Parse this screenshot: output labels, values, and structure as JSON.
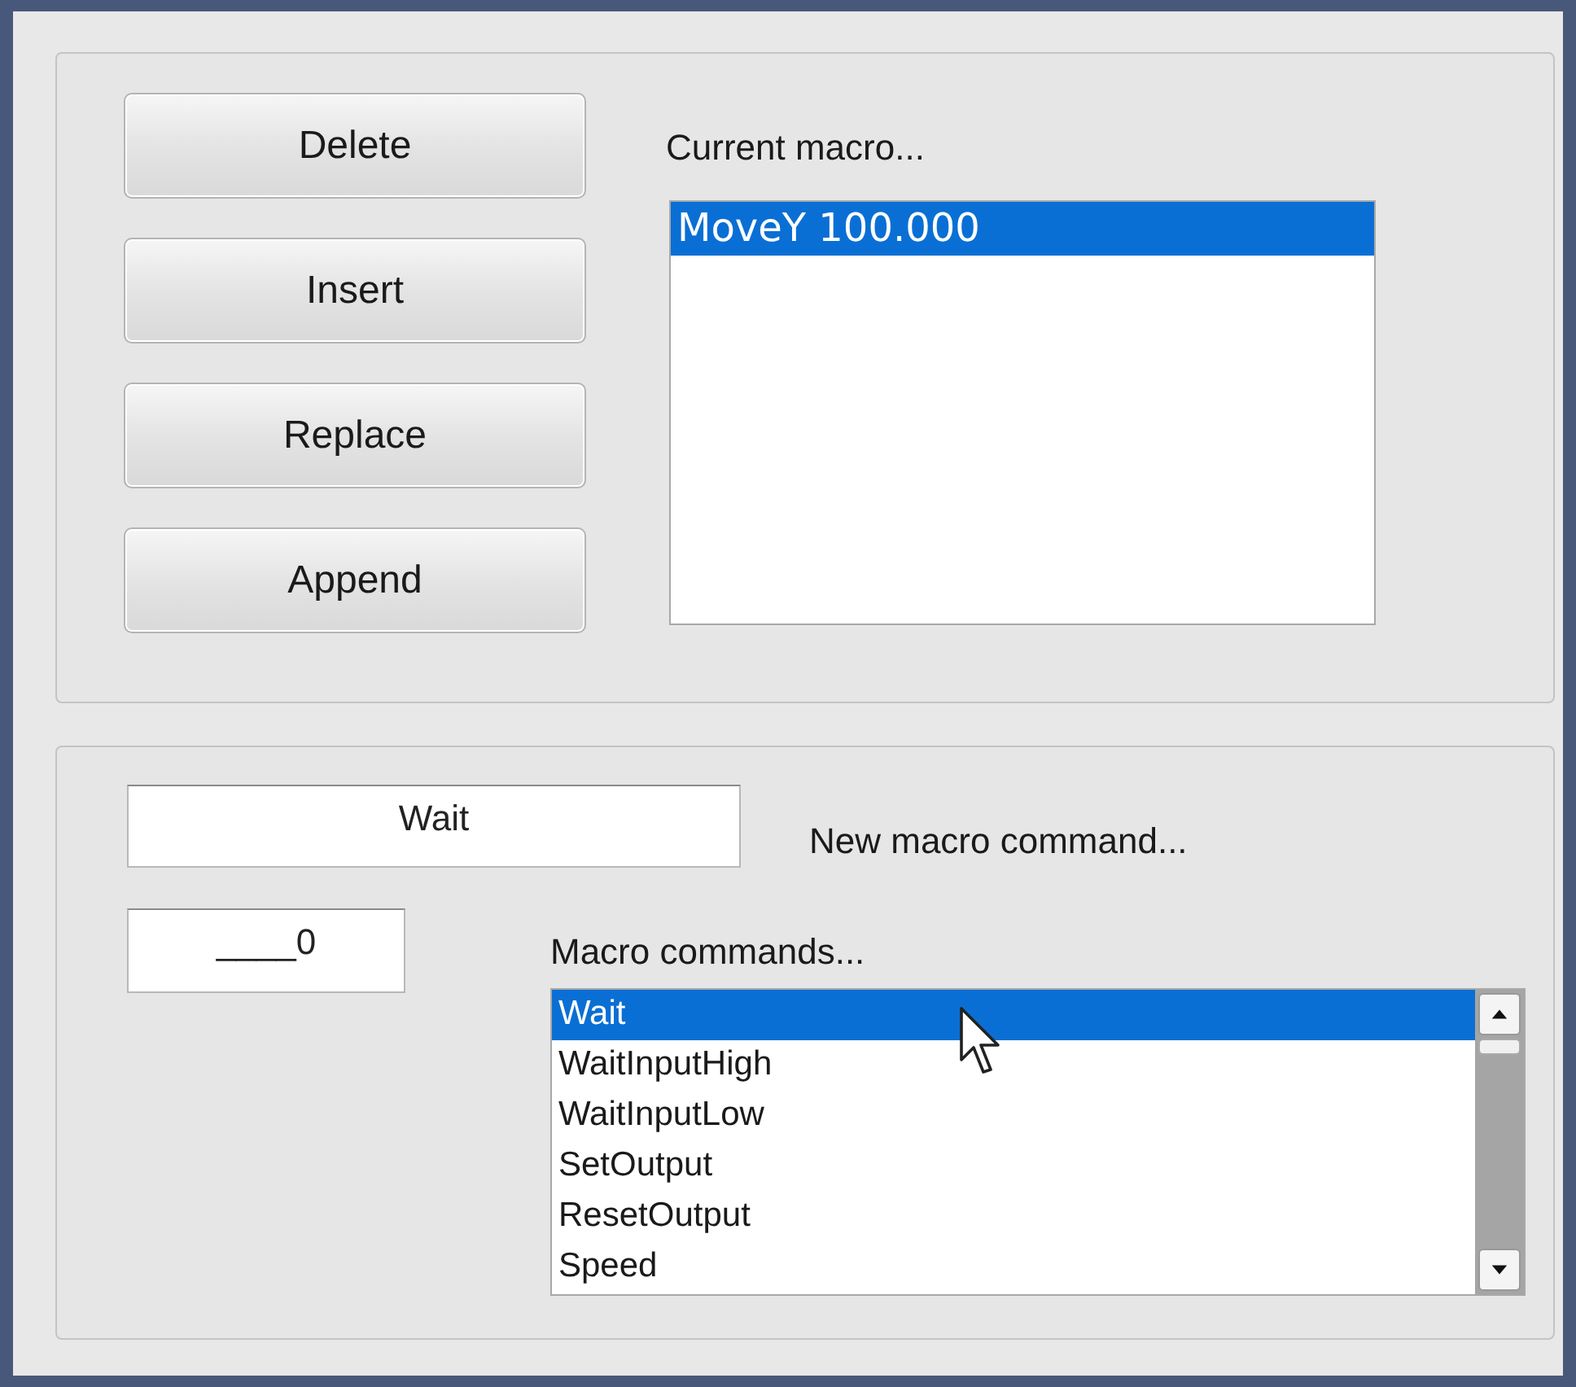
{
  "buttons": [
    "Delete",
    "Insert",
    "Replace",
    "Append"
  ],
  "current_macro": {
    "label": "Current macro...",
    "items": [
      {
        "text": "MoveY 100.000",
        "selected": true
      }
    ]
  },
  "new_command": {
    "value": "Wait",
    "label": "New macro command..."
  },
  "parameter": {
    "value": "____0"
  },
  "macro_commands": {
    "label": "Macro commands...",
    "items": [
      {
        "text": "Wait",
        "selected": true
      },
      {
        "text": "WaitInputHigh",
        "selected": false
      },
      {
        "text": "WaitInputLow",
        "selected": false
      },
      {
        "text": "SetOutput",
        "selected": false
      },
      {
        "text": "ResetOutput",
        "selected": false
      },
      {
        "text": "Speed",
        "selected": false
      }
    ]
  }
}
